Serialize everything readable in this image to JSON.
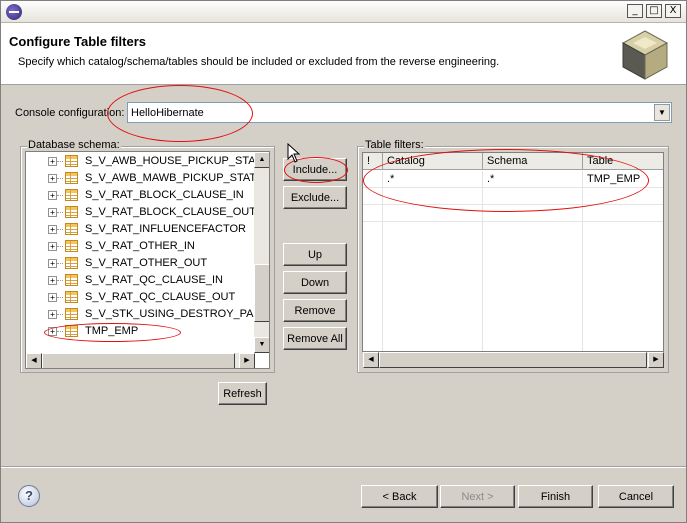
{
  "window": {
    "minimize_glyph": "_",
    "maximize_glyph": "□",
    "close_glyph": "X"
  },
  "header": {
    "title": "Configure Table filters",
    "description": "Specify which catalog/schema/tables should be included or excluded from the reverse engineering."
  },
  "console": {
    "label": "Console configuration:",
    "value": "HelloHibernate"
  },
  "schema": {
    "label": "Database schema:",
    "items": [
      "S_V_AWB_HOUSE_PICKUP_STATUS",
      "S_V_AWB_MAWB_PICKUP_STATUS",
      "S_V_RAT_BLOCK_CLAUSE_IN",
      "S_V_RAT_BLOCK_CLAUSE_OUT",
      "S_V_RAT_INFLUENCEFACTOR",
      "S_V_RAT_OTHER_IN",
      "S_V_RAT_OTHER_OUT",
      "S_V_RAT_QC_CLAUSE_IN",
      "S_V_RAT_QC_CLAUSE_OUT",
      "S_V_STK_USING_DESTROY_PAGE",
      "TMP_EMP"
    ],
    "expander_glyph": "+",
    "refresh": "Refresh"
  },
  "actions": {
    "include": "Include...",
    "exclude": "Exclude...",
    "up": "Up",
    "down": "Down",
    "remove": "Remove",
    "remove_all": "Remove All"
  },
  "filters": {
    "label": "Table filters:",
    "columns": [
      "!",
      "Catalog",
      "Schema",
      "Table"
    ],
    "rows": [
      {
        "flag": "",
        "catalog": ".*",
        "schema": ".*",
        "table": "TMP_EMP"
      }
    ]
  },
  "footer": {
    "help_glyph": "?",
    "back": "< Back",
    "next": "Next >",
    "finish": "Finish",
    "cancel": "Cancel"
  },
  "colors": {
    "annotation": "#e01010",
    "dialog_bg": "#d4d0c8",
    "field_border": "#7f9db9"
  }
}
